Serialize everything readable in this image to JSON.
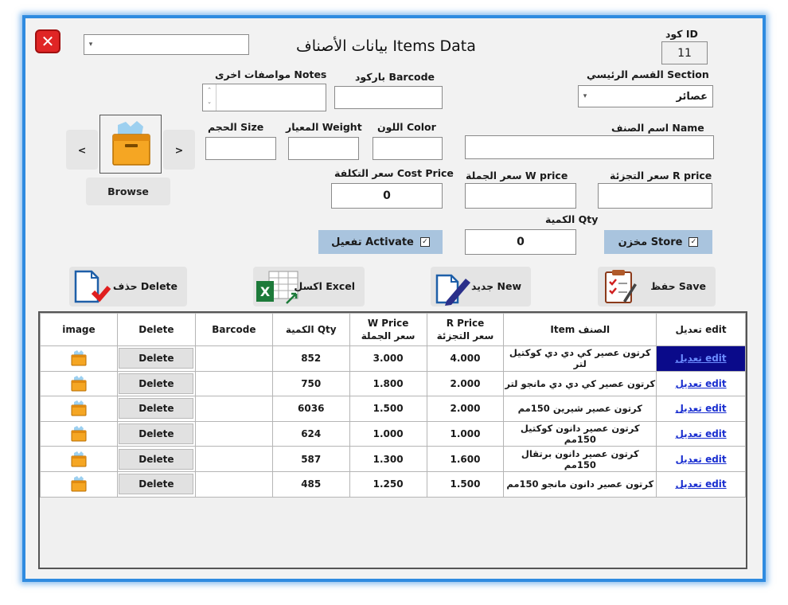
{
  "window": {
    "title": "بيانات الأصناف Items Data"
  },
  "header": {
    "id_label": "كود  ID",
    "id_value": "11",
    "top_combo_value": ""
  },
  "fields": {
    "section_label": "القسم الرئيسي Section",
    "section_value": "عصائر",
    "barcode_label": "باركود Barcode",
    "barcode_value": "",
    "notes_label": "مواصفات اخرى Notes",
    "notes_value": "",
    "name_label": "اسم الصنف Name",
    "name_value": "",
    "color_label": "اللون Color",
    "color_value": "",
    "weight_label": "المعيار Weight",
    "weight_value": "",
    "size_label": "الحجم Size",
    "size_value": "",
    "r_price_label": "سعر التجزئة R price",
    "r_price_value": "",
    "w_price_label": "سعر الجملة W price",
    "w_price_value": "",
    "cost_label": "سعر التكلفة Cost Price",
    "cost_value": "0",
    "qty_label": "الكمية Qty",
    "qty_value": "0"
  },
  "checks": {
    "store_label": "مخزن Store",
    "store_checked": true,
    "activate_label": "تفعيل Activate",
    "activate_checked": true
  },
  "image_nav": {
    "prev": "<",
    "next": ">",
    "browse": "Browse"
  },
  "actions": {
    "save": "حفظ Save",
    "new": "جديد New",
    "excel": "اكسل Excel",
    "delete": "حذف Delete"
  },
  "table": {
    "headers": {
      "edit": "تعديل edit",
      "item": "Item الصنف",
      "r_price_en": "R Price",
      "r_price_ar": "سعر التجزئة",
      "w_price_en": "W Price",
      "w_price_ar": "سعر الجملة",
      "qty": "الكمية Qty",
      "barcode": "Barcode",
      "delete": "Delete",
      "image": "image"
    },
    "rows": [
      {
        "edit": "تعديل edit",
        "item": "كرتون عصير كي دي دي كوكتيل لتر",
        "r_price": "4.000",
        "w_price": "3.000",
        "qty": "852",
        "barcode": "",
        "delete": "Delete"
      },
      {
        "edit": "تعديل edit",
        "item": "كرتون عصير كي دي دي مانجو لتر",
        "r_price": "2.000",
        "w_price": "1.800",
        "qty": "750",
        "barcode": "",
        "delete": "Delete"
      },
      {
        "edit": "تعديل edit",
        "item": "كرتون عصير شيرين 150مم",
        "r_price": "2.000",
        "w_price": "1.500",
        "qty": "6036",
        "barcode": "",
        "delete": "Delete"
      },
      {
        "edit": "تعديل edit",
        "item": "كرتون عصير دانون كوكتيل 150مم",
        "r_price": "1.000",
        "w_price": "1.000",
        "qty": "624",
        "barcode": "",
        "delete": "Delete"
      },
      {
        "edit": "تعديل edit",
        "item": "كرتون عصير دانون برتقال 150مم",
        "r_price": "1.600",
        "w_price": "1.300",
        "qty": "587",
        "barcode": "",
        "delete": "Delete"
      },
      {
        "edit": "تعديل edit",
        "item": "كرتون عصير دانون مانجو 150مم",
        "r_price": "1.500",
        "w_price": "1.250",
        "qty": "485",
        "barcode": "",
        "delete": "Delete"
      }
    ]
  },
  "colors": {
    "frame": "#2f8be0",
    "checkbox_bg": "#a9c4de",
    "link": "#1a2fd0",
    "selected_row": "#0a0a8a",
    "close_red": "#e02525",
    "box_orange": "#f5a623"
  },
  "icons": [
    "close-icon",
    "box-icon",
    "save-checklist-icon",
    "new-document-pen-icon",
    "excel-icon",
    "delete-document-icon",
    "chevron-down-icon"
  ]
}
